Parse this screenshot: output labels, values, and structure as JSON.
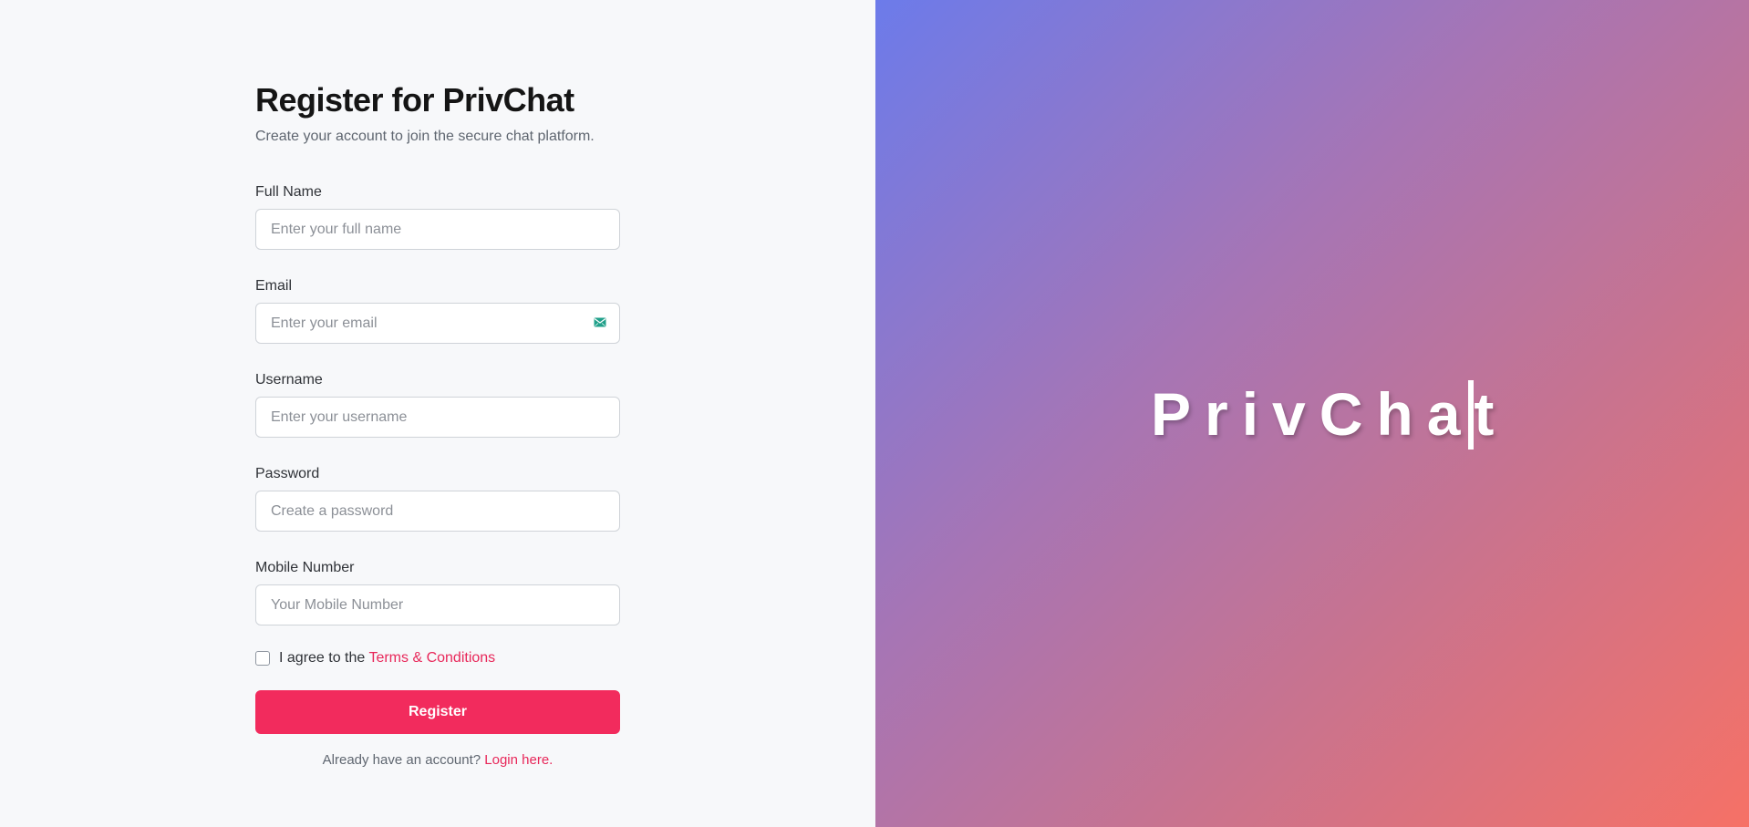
{
  "form": {
    "title": "Register for PrivChat",
    "subtitle": "Create your account to join the secure chat platform.",
    "fields": [
      {
        "label": "Full Name",
        "placeholder": "Enter your full name",
        "value": ""
      },
      {
        "label": "Email",
        "placeholder": "Enter your email",
        "value": "",
        "icon": "mail-icon"
      },
      {
        "label": "Username",
        "placeholder": "Enter your username",
        "value": ""
      },
      {
        "label": "Password",
        "placeholder": "Create a password",
        "value": ""
      },
      {
        "label": "Mobile Number",
        "placeholder": "Your Mobile Number",
        "value": ""
      }
    ],
    "agree_prefix": "I agree to the",
    "terms_link": "Terms & Conditions",
    "agree_checked": false,
    "register_label": "Register",
    "login_prompt": "Already have an account?",
    "login_link": "Login here."
  },
  "brand": {
    "text": "PrivChat"
  },
  "colors": {
    "accent": "#f22b5d",
    "link": "#e8285a",
    "icon": "#20a08a",
    "gradient_start": "#6c7bea",
    "gradient_end": "#f67166"
  }
}
